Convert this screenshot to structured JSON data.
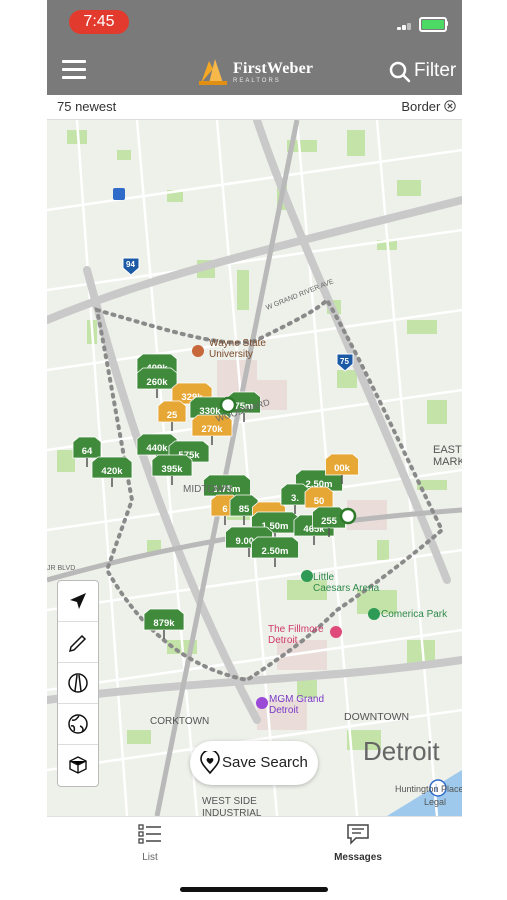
{
  "status_bar": {
    "time": "7:45",
    "time_pill_color": "#e23b2e",
    "battery_color": "#4cd964",
    "charging": true
  },
  "header": {
    "menu_icon": "hamburger-icon",
    "logo": {
      "name": "FirstWeber",
      "sub": "REALTORS"
    },
    "filter_label": "Filter",
    "filter_icon": "search-icon"
  },
  "info_bar": {
    "count_label": "75 newest",
    "border_label": "Border",
    "border_icon": "close-circle-icon"
  },
  "map": {
    "area_labels": [
      "Wayne State University",
      "MIDTOWN",
      "CORKTOWN",
      "DOWNTOWN",
      "WEST SIDE INDUSTRIAL",
      "EAST MARKET",
      "Detroit"
    ],
    "poi_labels": [
      "Little Caesars Arena",
      "Comerica Park",
      "The Fillmore Detroit",
      "MGM Grand Detroit",
      "Huntington Place"
    ],
    "road_labels": [
      "94",
      "75",
      "W GRAND RIVER AVE",
      "JR BLVD",
      "WOODWARD"
    ],
    "legal_label": "Legal",
    "listing_colors": {
      "active": "#3f8a3b",
      "pending": "#e6a735"
    },
    "listings": [
      {
        "price": "409k",
        "status": "active"
      },
      {
        "price": "260k",
        "status": "active"
      },
      {
        "price": "329k",
        "status": "pending"
      },
      {
        "price": "25",
        "status": "pending"
      },
      {
        "price": "330k",
        "status": "active"
      },
      {
        "price": "75m",
        "status": "active"
      },
      {
        "price": "270k",
        "status": "pending"
      },
      {
        "price": "440k",
        "status": "active"
      },
      {
        "price": "575k",
        "status": "active"
      },
      {
        "price": "395k",
        "status": "active"
      },
      {
        "price": "64",
        "status": "active"
      },
      {
        "price": "420k",
        "status": "active"
      },
      {
        "price": "1.75m",
        "status": "active"
      },
      {
        "price": "6",
        "status": "pending"
      },
      {
        "price": "85",
        "status": "active"
      },
      {
        "price": "500",
        "status": "pending"
      },
      {
        "price": "1.50m",
        "status": "active"
      },
      {
        "price": "9.00m",
        "status": "active"
      },
      {
        "price": "2.50m",
        "status": "active"
      },
      {
        "price": "2.50m",
        "status": "active"
      },
      {
        "price": "3.",
        "status": "active"
      },
      {
        "price": "50",
        "status": "pending"
      },
      {
        "price": "00k",
        "status": "pending"
      },
      {
        "price": "465k",
        "status": "active"
      },
      {
        "price": "255",
        "status": "active"
      },
      {
        "price": "879k",
        "status": "active"
      }
    ],
    "tools": [
      "locate-arrow-icon",
      "draw-pencil-icon",
      "commute-road-icon",
      "globe-icon",
      "3d-cube-icon"
    ]
  },
  "save_search": {
    "label": "Save Search",
    "icon": "heart-pin-icon"
  },
  "tab_bar": {
    "tabs": [
      {
        "label": "List",
        "icon": "list-icon"
      },
      {
        "label": "Messages",
        "icon": "messages-icon"
      }
    ]
  }
}
